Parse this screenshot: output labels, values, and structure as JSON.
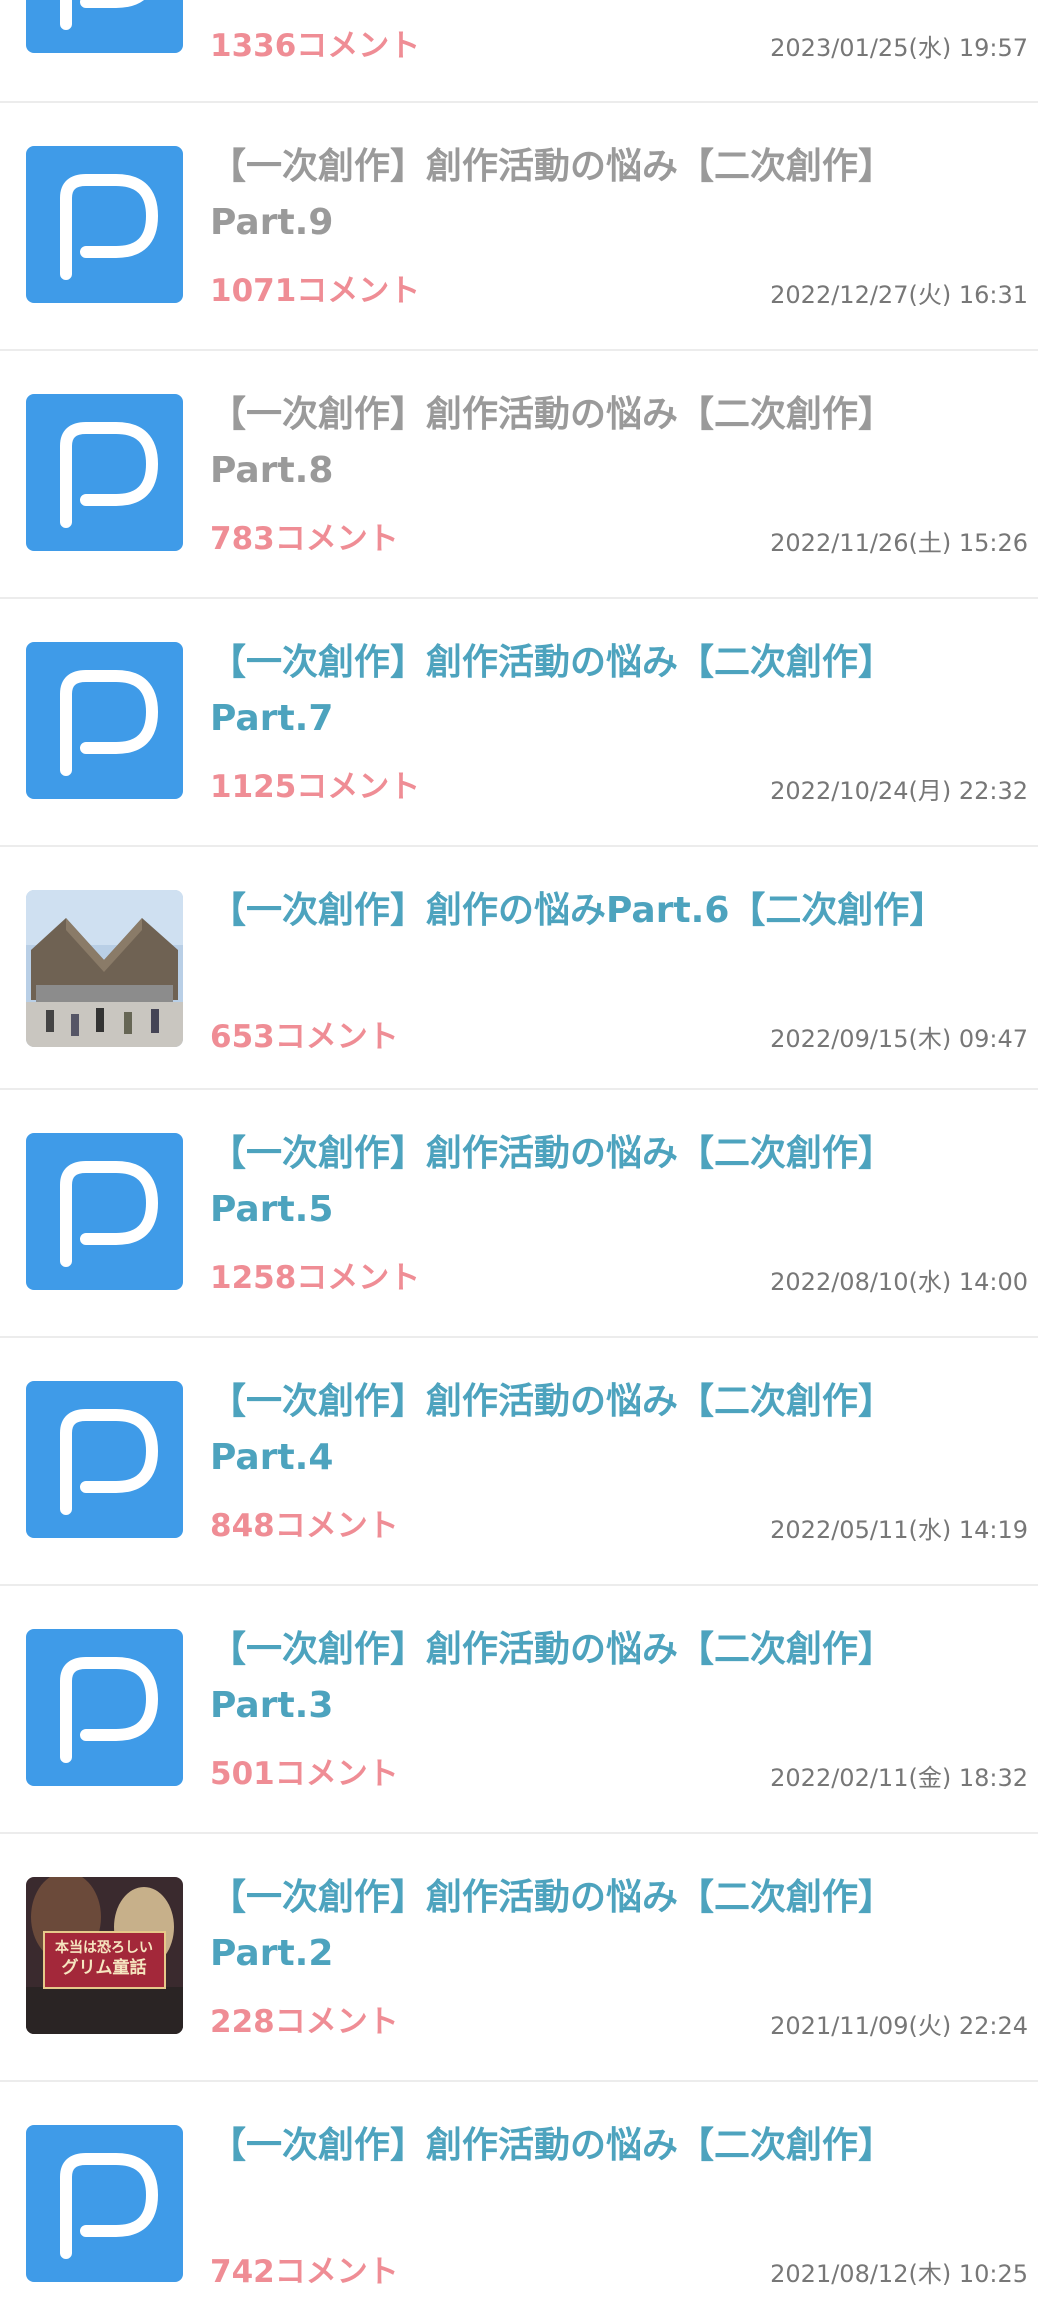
{
  "threads": [
    {
      "title_line1": "",
      "title_line2": "",
      "comments": "1336コメント",
      "date": "2023/01/25(水) 19:57",
      "thumb": "pixiv-icon",
      "visited": true
    },
    {
      "title_line1": "【一次創作】創作活動の悩み【二次創作】",
      "title_line2": "Part.9",
      "comments": "1071コメント",
      "date": "2022/12/27(火) 16:31",
      "thumb": "pixiv-icon",
      "visited": true
    },
    {
      "title_line1": "【一次創作】創作活動の悩み【二次創作】",
      "title_line2": "Part.8",
      "comments": "783コメント",
      "date": "2022/11/26(土) 15:26",
      "thumb": "pixiv-icon",
      "visited": true
    },
    {
      "title_line1": "【一次創作】創作活動の悩み【二次創作】",
      "title_line2": "Part.7",
      "comments": "1125コメント",
      "date": "2022/10/24(月) 22:32",
      "thumb": "pixiv-icon",
      "visited": false
    },
    {
      "title_line1": "【一次創作】創作の悩みPart.6【二次創作】",
      "title_line2": "",
      "comments": "653コメント",
      "date": "2022/09/15(木) 09:47",
      "thumb": "building-photo",
      "visited": false
    },
    {
      "title_line1": "【一次創作】創作活動の悩み【二次創作】",
      "title_line2": "Part.5",
      "comments": "1258コメント",
      "date": "2022/08/10(水) 14:00",
      "thumb": "pixiv-icon",
      "visited": false
    },
    {
      "title_line1": "【一次創作】創作活動の悩み【二次創作】",
      "title_line2": "Part.4",
      "comments": "848コメント",
      "date": "2022/05/11(水) 14:19",
      "thumb": "pixiv-icon",
      "visited": false
    },
    {
      "title_line1": "【一次創作】創作活動の悩み【二次創作】",
      "title_line2": "Part.3",
      "comments": "501コメント",
      "date": "2022/02/11(金) 18:32",
      "thumb": "pixiv-icon",
      "visited": false
    },
    {
      "title_line1": "【一次創作】創作活動の悩み【二次創作】",
      "title_line2": "Part.2",
      "comments": "228コメント",
      "date": "2021/11/09(火) 22:24",
      "thumb": "book-cover",
      "visited": false
    },
    {
      "title_line1": "【一次創作】創作活動の悩み【二次創作】",
      "title_line2": "",
      "comments": "742コメント",
      "date": "2021/08/12(木) 10:25",
      "thumb": "pixiv-icon",
      "visited": false
    }
  ],
  "book_cover_text": "本当は恐ろしいグリム童話",
  "colors": {
    "visited_title": "#9a9a9a",
    "unvisited_title": "#4da3be",
    "comments": "#ef8d95",
    "pixiv_blue": "#3f9be8"
  }
}
